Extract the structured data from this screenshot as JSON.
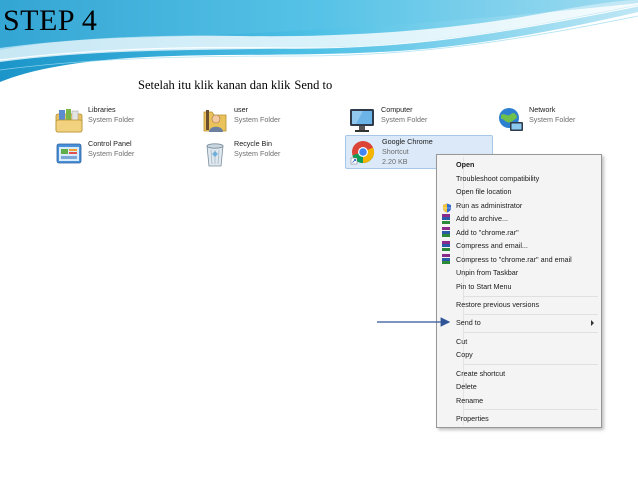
{
  "slide": {
    "title": "STEP 4",
    "caption_prefix": "Setelah itu klik kanan dan klik",
    "caption_emphasis": "Send to"
  },
  "desktop": {
    "items": [
      {
        "name": "Libraries",
        "type": "System Folder",
        "icon": "libraries-icon"
      },
      {
        "name": "user",
        "type": "System Folder",
        "icon": "user-folder-icon"
      },
      {
        "name": "Computer",
        "type": "System Folder",
        "icon": "computer-icon"
      },
      {
        "name": "Network",
        "type": "System Folder",
        "icon": "network-icon"
      },
      {
        "name": "Control Panel",
        "type": "System Folder",
        "icon": "control-panel-icon"
      },
      {
        "name": "Recycle Bin",
        "type": "System Folder",
        "icon": "recycle-bin-icon"
      },
      {
        "name": "Google Chrome",
        "type": "Shortcut",
        "size": "2.20 KB",
        "icon": "chrome-icon",
        "selected": true
      }
    ]
  },
  "context_menu": {
    "items": [
      {
        "label": "Open",
        "bold": true
      },
      {
        "label": "Troubleshoot compatibility"
      },
      {
        "label": "Open file location"
      },
      {
        "label": "Run as administrator",
        "icon": "shield-icon"
      },
      {
        "label": "Add to archive...",
        "icon": "winrar-icon"
      },
      {
        "label": "Add to \"chrome.rar\"",
        "icon": "winrar-icon"
      },
      {
        "label": "Compress and email...",
        "icon": "winrar-icon"
      },
      {
        "label": "Compress to \"chrome.rar\" and email",
        "icon": "winrar-icon"
      },
      {
        "label": "Unpin from Taskbar"
      },
      {
        "label": "Pin to Start Menu"
      },
      {
        "label": "Restore previous versions"
      },
      {
        "label": "Send to",
        "submenu": true,
        "highlighted_by_arrow": true
      },
      {
        "label": "Cut"
      },
      {
        "label": "Copy"
      },
      {
        "label": "Create shortcut"
      },
      {
        "label": "Delete"
      },
      {
        "label": "Rename"
      },
      {
        "label": "Properties"
      }
    ]
  },
  "colors": {
    "slide_wave": "#2aa8d8",
    "arrow": "#2f5597",
    "selection": "#dbe9f8",
    "menu_bg": "#f4f4f4"
  }
}
